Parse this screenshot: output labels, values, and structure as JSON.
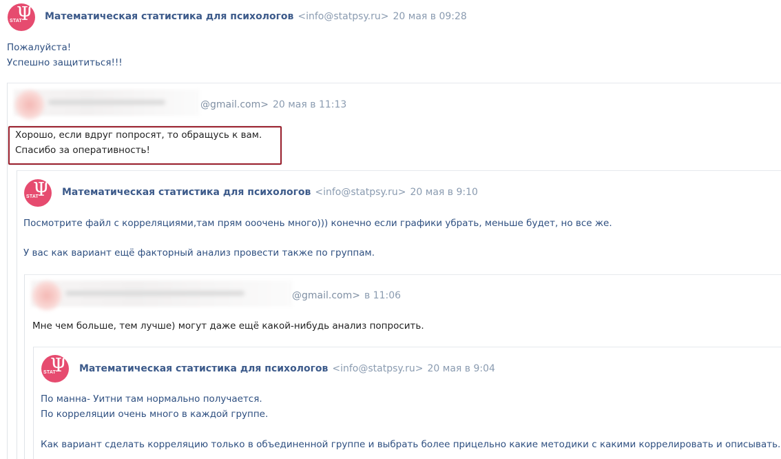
{
  "messages": [
    {
      "sender": "Математическая статистика для психологов",
      "email": "<info@statpsy.ru>",
      "date": "20 мая в 09:28",
      "lines": [
        "Пожалуйста!",
        "Успешно защититься!!!"
      ]
    },
    {
      "email": "@gmail.com>",
      "date": "20 мая в 11:13",
      "lines": [
        "Хорошо, если вдруг попросят, то обращусь к вам.",
        "Спасибо за оперативность!"
      ]
    },
    {
      "sender": "Математическая статистика для психологов",
      "email": "<info@statpsy.ru>",
      "date": "20 мая в 9:10",
      "lines": [
        "Посмотрите файл с корреляциями,там прям ооочень много))) конечно если графики убрать, меньше будет, но все же.",
        "У вас как вариант ещё факторный анализ провести также по группам."
      ]
    },
    {
      "email": "@gmail.com>",
      "date": "в 11:06",
      "lines": [
        "Мне чем больше, тем лучше) могут даже ещё какой-нибудь анализ попросить."
      ]
    },
    {
      "sender": "Математическая статистика для психологов",
      "email": "<info@statpsy.ru>",
      "date": "20 мая в 9:04",
      "lines": [
        "По манна- Уитни там нормально получается.",
        "По корреляции очень много в каждой группе.",
        "Как вариант сделать корреляцию только в объединенной группе и выбрать более прицельно какие методики с какими коррелировать и описывать."
      ]
    }
  ],
  "avatar": {
    "psi": "Ψ",
    "stat": "STAT"
  },
  "colors": {
    "avatar_bg": "#e64b6f",
    "sender": "#3c5a8a",
    "meta": "#8a9bb0",
    "highlight": "#9a1f2c"
  }
}
